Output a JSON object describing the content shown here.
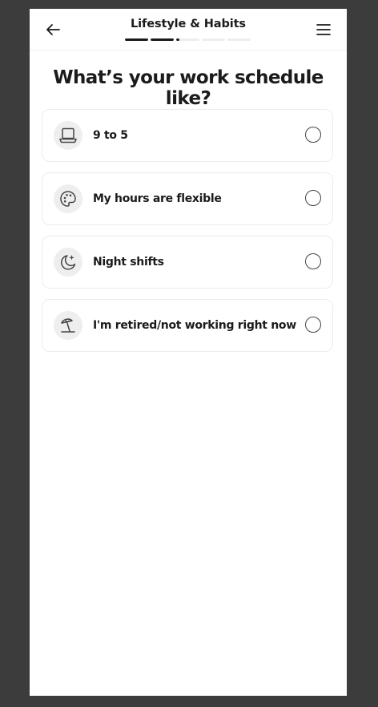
{
  "header": {
    "title": "Lifestyle & Habits",
    "back_icon": "arrow-left-icon",
    "menu_icon": "hamburger-menu-icon"
  },
  "progress": {
    "steps": [
      1,
      1,
      0.15,
      0,
      0
    ],
    "active_color": "#1b1b1b",
    "track_color": "#eeeeee"
  },
  "question": "What’s your work schedule like?",
  "options": [
    {
      "label": "9 to 5",
      "icon": "laptop-icon",
      "selected": false
    },
    {
      "label": "My hours are flexible",
      "icon": "palette-icon",
      "selected": false
    },
    {
      "label": "Night shifts",
      "icon": "moon-sparkle-icon",
      "selected": false
    },
    {
      "label": "I'm retired/not working right now",
      "icon": "beach-umbrella-icon",
      "selected": false
    }
  ],
  "colors": {
    "text": "#1b1b1b",
    "icon_bg": "#eeeeee",
    "border": "#ececec",
    "backdrop": "#3c3c3c"
  }
}
